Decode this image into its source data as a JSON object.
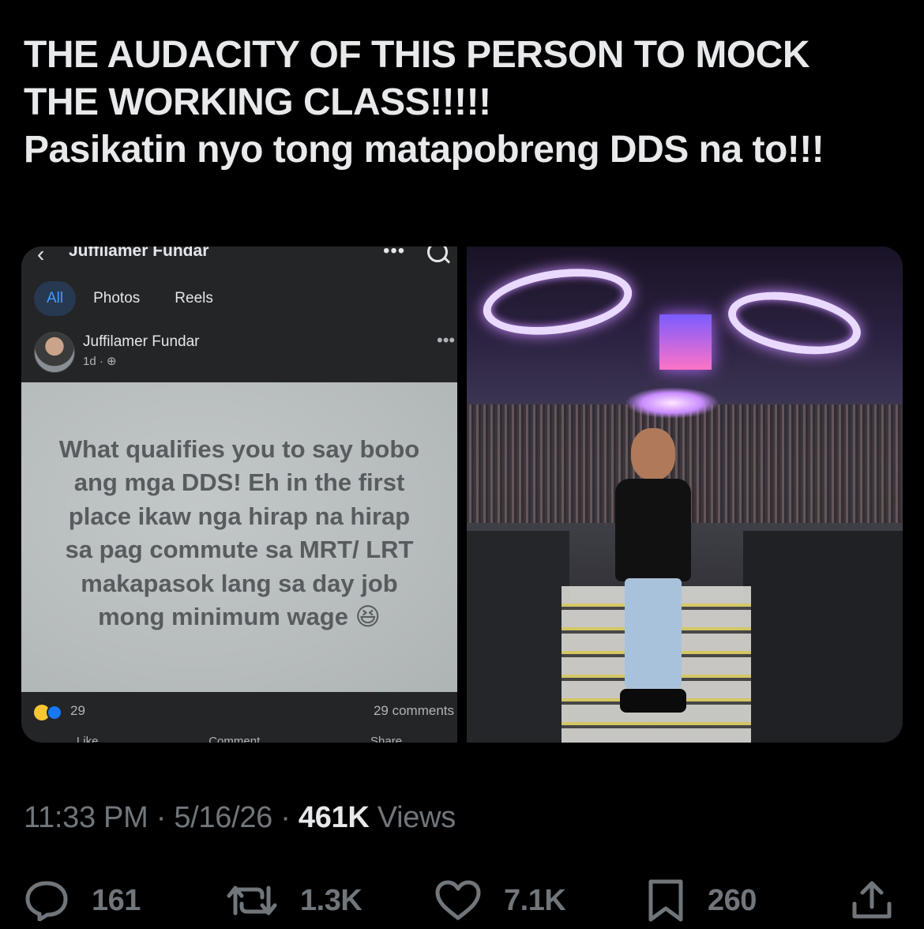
{
  "tweet": {
    "line1": "THE AUDACITY OF THIS PERSON TO MOCK",
    "line2": "THE WORKING CLASS!!!!!",
    "line3": "Pasikatin nyo tong matapobreng DDS na to!!!"
  },
  "facebook_screenshot": {
    "top_name": "Juffilamer Fundar",
    "tabs": [
      "All",
      "Photos",
      "Reels"
    ],
    "active_tab": "All",
    "author": "Juffilamer Fundar",
    "post_meta": "1d ·",
    "post_text": "What qualifies you to say bobo ang mga DDS! Eh in the first place ikaw nga hirap na hirap sa pag commute sa MRT/ LRT makapasok lang sa day job mong minimum wage 😆",
    "reaction_count": "29",
    "comments": "29 comments",
    "actions": [
      "Like",
      "Comment",
      "Share"
    ]
  },
  "meta": {
    "time": "11:33 PM",
    "sep1": " · ",
    "date": "5/16/26",
    "sep2": " · ",
    "views_count": "461K",
    "views_label": " Views"
  },
  "engagement": {
    "replies": "161",
    "reposts": "1.3K",
    "likes": "7.1K",
    "bookmarks": "260"
  },
  "icons": {
    "reply": "reply-icon",
    "repost": "repost-icon",
    "like": "heart-icon",
    "bookmark": "bookmark-icon",
    "share": "share-icon"
  },
  "colors": {
    "background": "#000000",
    "text": "#e7e9ea",
    "secondary": "#71767b",
    "fb_active_tab": "#4599ff"
  }
}
